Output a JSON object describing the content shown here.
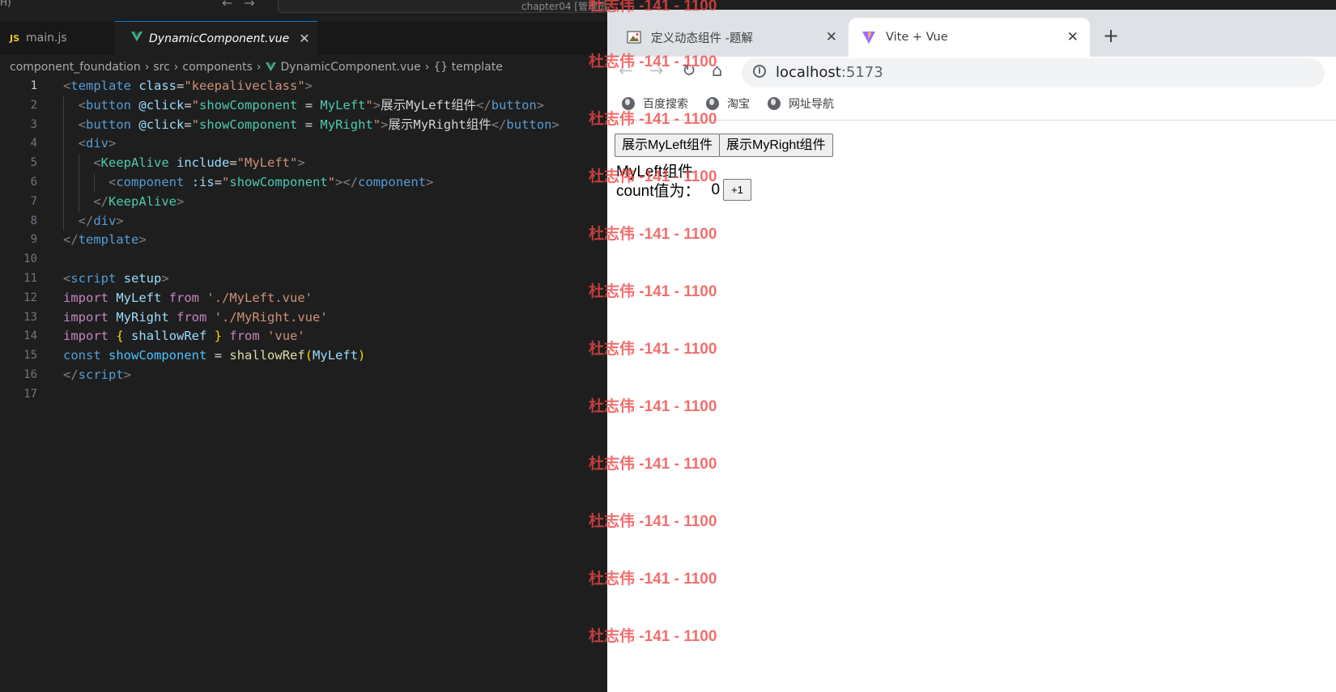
{
  "vscode": {
    "titlebar": {
      "left_fragment": "H)",
      "search_text": "chapter04 [管理员]"
    },
    "tabs": [
      {
        "label": "main.js",
        "icon": "js-file-icon",
        "active": false
      },
      {
        "label": "DynamicComponent.vue",
        "icon": "vue-file-icon",
        "active": true
      }
    ],
    "breadcrumb": [
      "component_foundation",
      "src",
      "components",
      "DynamicComponent.vue",
      "{} template"
    ],
    "current_line": 1,
    "line_numbers": [
      "1",
      "2",
      "3",
      "4",
      "5",
      "6",
      "7",
      "8",
      "9",
      "10",
      "11",
      "12",
      "13",
      "14",
      "15",
      "16",
      "17"
    ]
  },
  "browser": {
    "tabs": [
      {
        "title": "定义动态组件 -题解",
        "icon": "exercise-favicon-icon",
        "active": false
      },
      {
        "title": "Vite + Vue",
        "icon": "vite-favicon-icon",
        "active": true
      }
    ],
    "url": {
      "host": "localhost",
      "port": ":5173"
    },
    "bookmarks": [
      "百度搜索",
      "淘宝",
      "网址导航"
    ],
    "page": {
      "button_left": "展示MyLeft组件",
      "button_right": "展示MyRight组件",
      "component_title": "MyLeft组件",
      "count_label": "count值为：",
      "count_value": "0",
      "increment_label": "+1"
    }
  },
  "watermark": {
    "text": "杜志伟 -141 - 1100",
    "color": "#ee4646"
  }
}
